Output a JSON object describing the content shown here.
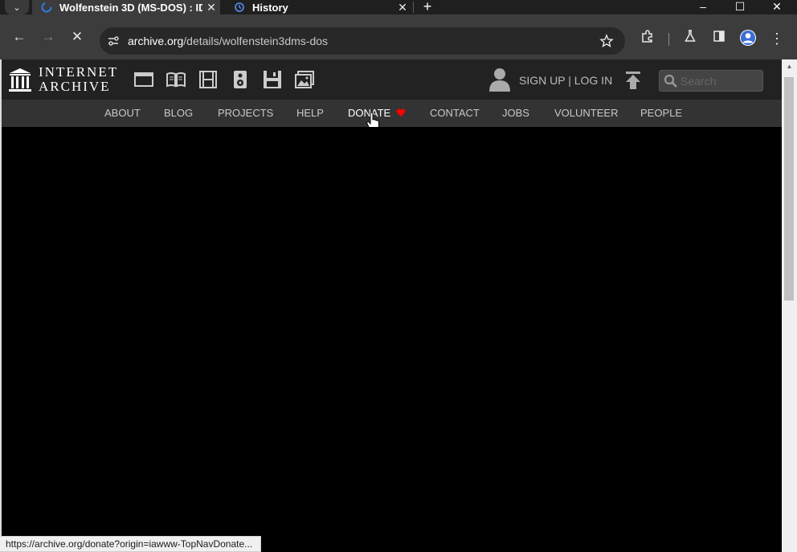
{
  "browser": {
    "tabs": [
      {
        "title": "Wolfenstein 3D (MS-DOS) : ID",
        "icon": "loading-spinner-icon",
        "close_label": "✕"
      },
      {
        "title": "History",
        "icon": "history-icon",
        "close_label": "✕"
      }
    ],
    "tab_menu_label": "⌄",
    "new_tab_label": "+",
    "window_controls": {
      "minimize": "–",
      "maximize": "☐",
      "close": "✕"
    },
    "url_host": "archive.org",
    "url_path": "/details/wolfenstein3dms-dos",
    "nav": {
      "back": "←",
      "forward": "→",
      "stop": "✕"
    },
    "status_url": "https://archive.org/donate?origin=iawww-TopNavDonate..."
  },
  "ia": {
    "logo_line1": "INTERNET",
    "logo_line2": "ARCHIVE",
    "media_icons": [
      "web-icon",
      "texts-icon",
      "video-icon",
      "audio-icon",
      "software-icon",
      "images-icon"
    ],
    "signup_label": "SIGN UP | LOG IN",
    "search_placeholder": "Search",
    "nav_items": [
      {
        "label": "ABOUT"
      },
      {
        "label": "BLOG"
      },
      {
        "label": "PROJECTS"
      },
      {
        "label": "HELP"
      },
      {
        "label": "DONATE"
      },
      {
        "label": "CONTACT"
      },
      {
        "label": "JOBS"
      },
      {
        "label": "VOLUNTEER"
      },
      {
        "label": "PEOPLE"
      }
    ],
    "colors": {
      "header_bg": "#222222",
      "nav_bg": "#333333",
      "donate_heart": "#ff0000"
    }
  }
}
